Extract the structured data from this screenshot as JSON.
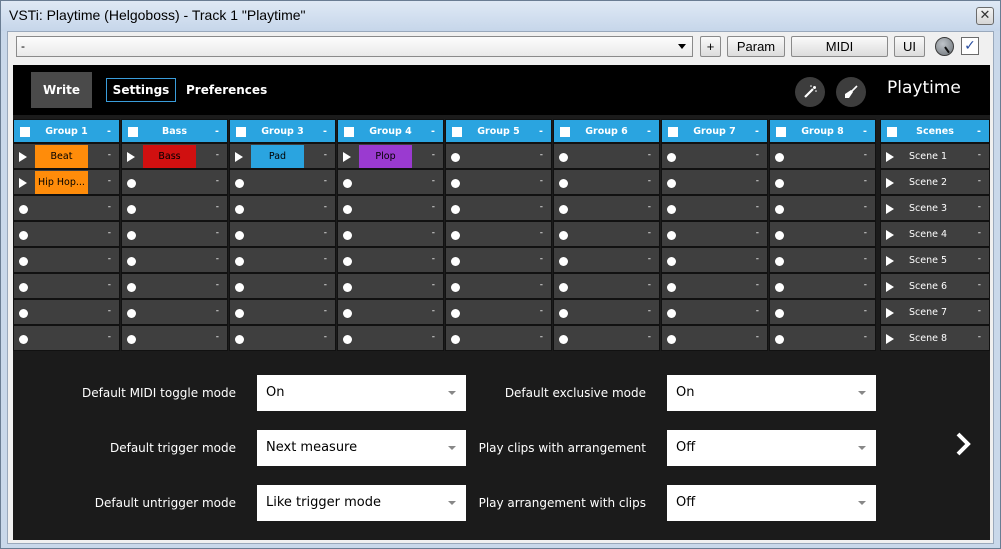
{
  "window": {
    "title": "VSTi: Playtime (Helgoboss) - Track 1 \"Playtime\"",
    "close_glyph": "✕"
  },
  "toolbar": {
    "preset": "-",
    "plus_label": "+",
    "param_label": "Param",
    "midi_label": "MIDI",
    "ui_label": "UI",
    "checked_glyph": "✓"
  },
  "header": {
    "write_label": "Write",
    "settings_label": "Settings",
    "preferences_label": "Preferences",
    "brand": "Playtime"
  },
  "groups": [
    {
      "name": "Group 1",
      "dash": "-",
      "cells": [
        {
          "state": "play",
          "clip": "Beat",
          "color": "#ff8c0a"
        },
        {
          "state": "play",
          "clip": "Hip Hop...",
          "color": "#ff8c0a"
        },
        {
          "state": "dot"
        },
        {
          "state": "dot"
        },
        {
          "state": "dot"
        },
        {
          "state": "dot"
        },
        {
          "state": "dot"
        },
        {
          "state": "dot"
        }
      ]
    },
    {
      "name": "Bass",
      "dash": "-",
      "cells": [
        {
          "state": "play",
          "clip": "Bass",
          "color": "#d01010"
        },
        {
          "state": "dot"
        },
        {
          "state": "dot"
        },
        {
          "state": "dot"
        },
        {
          "state": "dot"
        },
        {
          "state": "dot"
        },
        {
          "state": "dot"
        },
        {
          "state": "dot"
        }
      ]
    },
    {
      "name": "Group 3",
      "dash": "-",
      "cells": [
        {
          "state": "play",
          "clip": "Pad",
          "color": "#2aa4e0"
        },
        {
          "state": "dot"
        },
        {
          "state": "dot"
        },
        {
          "state": "dot"
        },
        {
          "state": "dot"
        },
        {
          "state": "dot"
        },
        {
          "state": "dot"
        },
        {
          "state": "dot"
        }
      ]
    },
    {
      "name": "Group 4",
      "dash": "-",
      "cells": [
        {
          "state": "play",
          "clip": "Plop",
          "color": "#9a3ad0"
        },
        {
          "state": "dot"
        },
        {
          "state": "dot"
        },
        {
          "state": "dot"
        },
        {
          "state": "dot"
        },
        {
          "state": "dot"
        },
        {
          "state": "dot"
        },
        {
          "state": "dot"
        }
      ]
    },
    {
      "name": "Group 5",
      "dash": "-",
      "cells": [
        {
          "state": "dot"
        },
        {
          "state": "dot"
        },
        {
          "state": "dot"
        },
        {
          "state": "dot"
        },
        {
          "state": "dot"
        },
        {
          "state": "dot"
        },
        {
          "state": "dot"
        },
        {
          "state": "dot"
        }
      ]
    },
    {
      "name": "Group 6",
      "dash": "-",
      "cells": [
        {
          "state": "dot"
        },
        {
          "state": "dot"
        },
        {
          "state": "dot"
        },
        {
          "state": "dot"
        },
        {
          "state": "dot"
        },
        {
          "state": "dot"
        },
        {
          "state": "dot"
        },
        {
          "state": "dot"
        }
      ]
    },
    {
      "name": "Group 7",
      "dash": "-",
      "cells": [
        {
          "state": "dot"
        },
        {
          "state": "dot"
        },
        {
          "state": "dot"
        },
        {
          "state": "dot"
        },
        {
          "state": "dot"
        },
        {
          "state": "dot"
        },
        {
          "state": "dot"
        },
        {
          "state": "dot"
        }
      ]
    },
    {
      "name": "Group 8",
      "dash": "-",
      "cells": [
        {
          "state": "dot"
        },
        {
          "state": "dot"
        },
        {
          "state": "dot"
        },
        {
          "state": "dot"
        },
        {
          "state": "dot"
        },
        {
          "state": "dot"
        },
        {
          "state": "dot"
        },
        {
          "state": "dot"
        }
      ]
    }
  ],
  "scenes": {
    "name": "Scenes",
    "dash": "-",
    "items": [
      "Scene 1",
      "Scene 2",
      "Scene 3",
      "Scene 4",
      "Scene 5",
      "Scene 6",
      "Scene 7",
      "Scene 8"
    ]
  },
  "settings": {
    "left": [
      {
        "label": "Default MIDI toggle mode",
        "value": "On"
      },
      {
        "label": "Default trigger mode",
        "value": "Next measure"
      },
      {
        "label": "Default untrigger mode",
        "value": "Like trigger mode"
      }
    ],
    "right": [
      {
        "label": "Default exclusive mode",
        "value": "On"
      },
      {
        "label": "Play clips with arrangement",
        "value": "Off"
      },
      {
        "label": "Play arrangement with clips",
        "value": "Off"
      }
    ]
  }
}
